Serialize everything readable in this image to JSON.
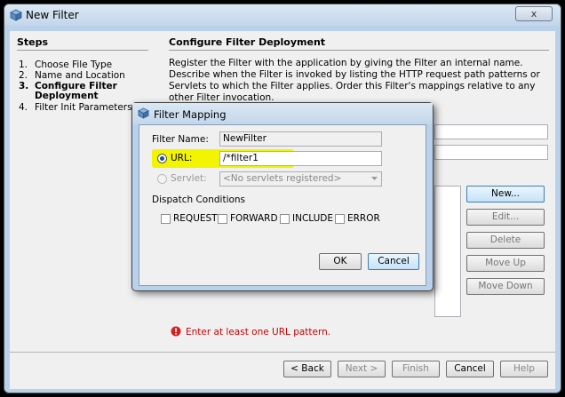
{
  "window": {
    "title": "New Filter",
    "close_glyph": "x"
  },
  "steps": {
    "title": "Steps",
    "items": [
      {
        "num": "1.",
        "label": "Choose File Type"
      },
      {
        "num": "2.",
        "label": "Name and Location"
      },
      {
        "num": "3.",
        "label": "Configure Filter Deployment"
      },
      {
        "num": "4.",
        "label": "Filter Init Parameters"
      }
    ]
  },
  "main": {
    "title": "Configure Filter Deployment",
    "description": "Register the Filter with the application by giving the Filter an internal name. Describe when the Filter is invoked by listing the HTTP request path patterns or Servlets to which the Filter applies. Order this Filter's mappings relative to any other Filter invocation."
  },
  "mapping_buttons": {
    "new": "New...",
    "edit": "Edit...",
    "delete": "Delete",
    "move_up": "Move Up",
    "move_down": "Move Down"
  },
  "error_message": "Enter at least one URL pattern.",
  "nav": {
    "back": "< Back",
    "next": "Next >",
    "finish": "Finish",
    "cancel": "Cancel",
    "help": "Help"
  },
  "dialog": {
    "title": "Filter Mapping",
    "filter_name_label": "Filter Name:",
    "filter_name_value": "NewFilter",
    "url_label": "URL:",
    "url_value": "/*filter1",
    "servlet_label": "Servlet:",
    "servlet_value": "<No servlets registered>",
    "dispatch_title": "Dispatch Conditions",
    "conditions": [
      "REQUEST",
      "FORWARD",
      "INCLUDE",
      "ERROR"
    ],
    "ok": "OK",
    "cancel": "Cancel"
  },
  "colors": {
    "highlight": "#f2f400",
    "error": "#cc0000",
    "title_bar": "#c3d6ea"
  }
}
